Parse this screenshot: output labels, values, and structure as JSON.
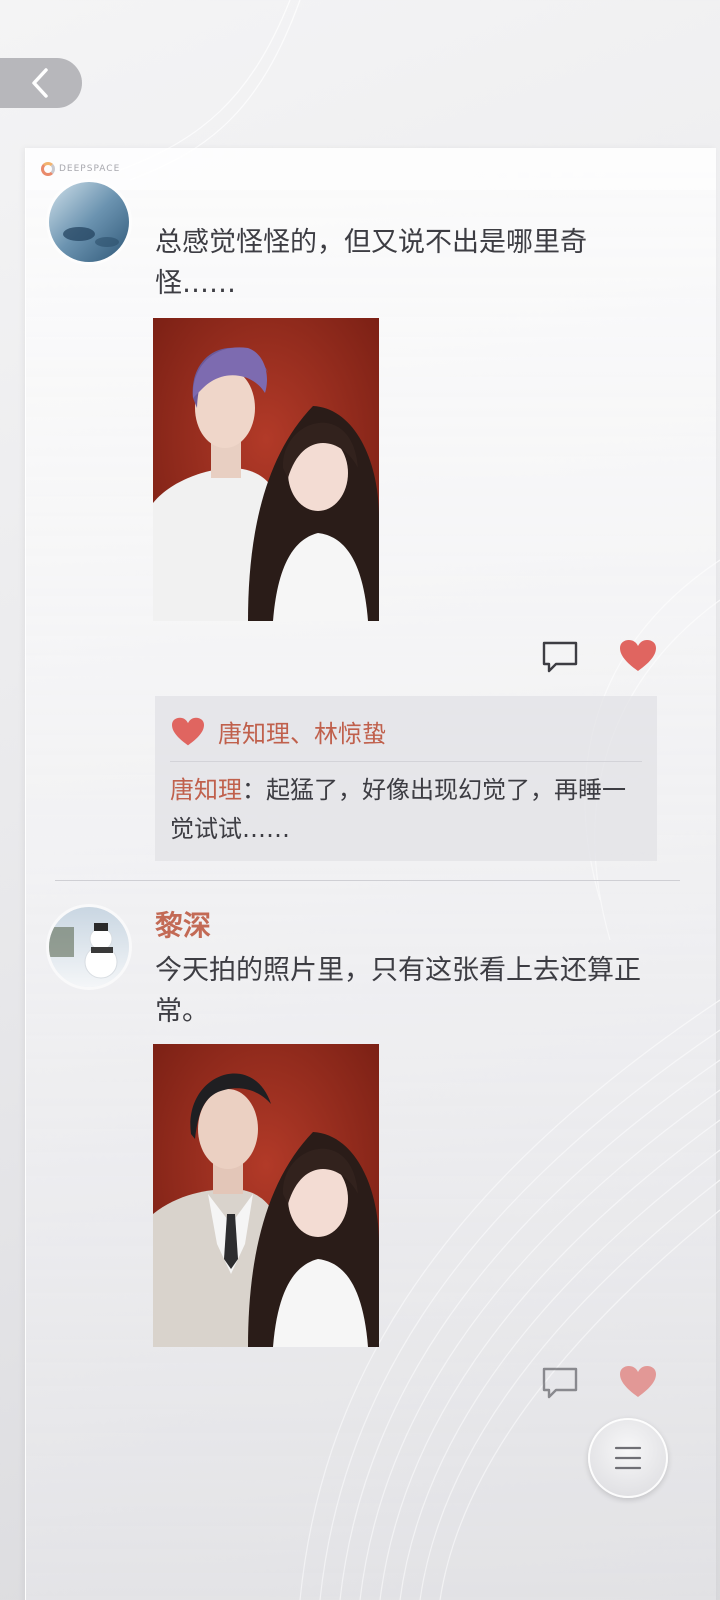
{
  "panel": {
    "brand": "DEEPSPACE"
  },
  "post1": {
    "text": "总感觉怪怪的，但又说不出是哪里奇怪……",
    "liked_by": "唐知理、林惊蛰",
    "comment": {
      "author": "唐知理",
      "sep": "：",
      "text": "起猛了，好像出现幻觉了，再睡一觉试试……"
    }
  },
  "post2": {
    "author": "黎深",
    "text": "今天拍的照片里，只有这张看上去还算正常。"
  },
  "colors": {
    "accent": "#c36a55",
    "heart": "#e06560",
    "photo_bg": "#8e2418"
  },
  "icons": [
    "back-arrow-icon",
    "comment-icon",
    "heart-icon",
    "menu-icon"
  ]
}
